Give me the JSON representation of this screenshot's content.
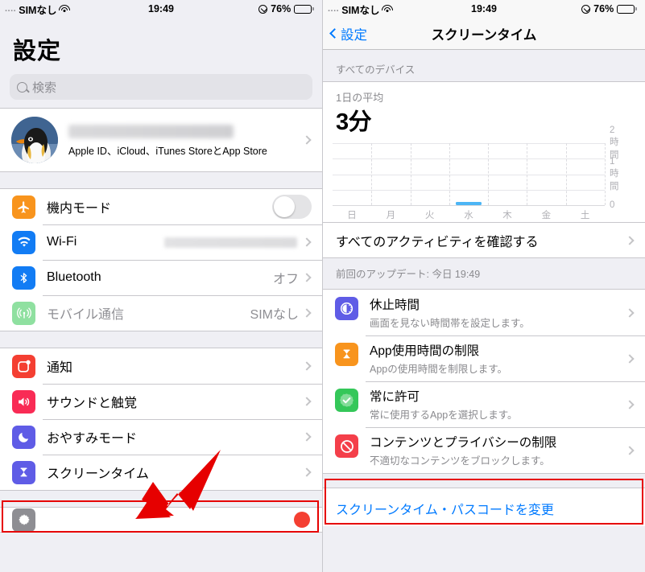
{
  "statusbar": {
    "dots": "....",
    "carrier": "SIMなし",
    "wifi_icon": "wifi-icon",
    "time": "19:49",
    "lowpower_icon": "low-power-icon",
    "battery_percent": "76%"
  },
  "left_panel": {
    "title": "設定",
    "search": {
      "placeholder": "検索",
      "icon": "search-icon"
    },
    "account": {
      "avatar": "penguin-avatar",
      "name_redacted": "",
      "subtitle": "Apple ID、iCloud、iTunes StoreとApp Store"
    },
    "group1": [
      {
        "label": "機内モード",
        "icon": "airplane-icon",
        "color": "#f8941d",
        "control": "toggle",
        "toggle_on": false
      },
      {
        "label": "Wi-Fi",
        "icon": "wifi-icon",
        "color": "#127cf4",
        "value_redacted": true
      },
      {
        "label": "Bluetooth",
        "icon": "bluetooth-icon",
        "color": "#127cf4",
        "value": "オフ"
      },
      {
        "label": "モバイル通信",
        "icon": "cellular-icon",
        "color": "#8fe0a0",
        "value": "SIMなし",
        "dimmed": true
      }
    ],
    "group2": [
      {
        "label": "通知",
        "icon": "notifications-icon",
        "color": "#f43f32"
      },
      {
        "label": "サウンドと触覚",
        "icon": "sounds-icon",
        "color": "#f92b55"
      },
      {
        "label": "おやすみモード",
        "icon": "do-not-disturb-icon",
        "color": "#5f5ce6"
      },
      {
        "label": "スクリーンタイム",
        "icon": "screen-time-icon",
        "color": "#5f5ce6",
        "highlighted": true
      }
    ],
    "group3_partial": {
      "label": "",
      "icon": "general-gear-icon",
      "color": "#8e8e93",
      "badge": ""
    }
  },
  "right_panel": {
    "nav": {
      "back_label": "設定",
      "title": "スクリーンタイム",
      "back_icon": "chevron-left-icon"
    },
    "devices_header": "すべてのデバイス",
    "chart_card": {
      "subtitle": "1日の平均",
      "value": "3分"
    },
    "all_activity_label": "すべてのアクティビティを確認する",
    "last_update": "前回のアップデート: 今日 19:49",
    "items": [
      {
        "title": "休止時間",
        "subtitle": "画面を見ない時間帯を設定します。",
        "icon": "downtime-moon-icon",
        "color": "#5f5ce6"
      },
      {
        "title": "App使用時間の制限",
        "subtitle": "Appの使用時間を制限します。",
        "icon": "hourglass-icon",
        "color": "#f8941d"
      },
      {
        "title": "常に許可",
        "subtitle": "常に使用するAppを選択します。",
        "icon": "always-allowed-check-icon",
        "color": "#34c759"
      },
      {
        "title": "コンテンツとプライバシーの制限",
        "subtitle": "不適切なコンテンツをブロックします。",
        "icon": "restrictions-block-icon",
        "color": "#f43f4a",
        "highlighted": true
      }
    ],
    "passcode_link": "スクリーンタイム・パスコードを変更"
  },
  "annotations": {
    "highlight_color": "#e60000",
    "arrow_color": "#e60000",
    "arrow_left_target": "スクリーンタイム",
    "arrow_right_target": "コンテンツとプライバシーの制限"
  },
  "chart_data": {
    "type": "bar",
    "title": "1日の平均",
    "subtitle": "3分",
    "categories": [
      "日",
      "月",
      "火",
      "水",
      "木",
      "金",
      "土"
    ],
    "values": [
      0,
      0,
      0,
      3,
      0,
      0,
      0
    ],
    "unit": "分",
    "ylim": [
      0,
      120
    ],
    "ytick_values": [
      0,
      60,
      120
    ],
    "ytick_labels": [
      "0",
      "1時間",
      "2時間"
    ],
    "gridlines": [
      0,
      30,
      60,
      90,
      120
    ],
    "grid": true,
    "bar_color": "#4cb5f5",
    "xlabel": "",
    "ylabel": "",
    "legend": "none"
  }
}
